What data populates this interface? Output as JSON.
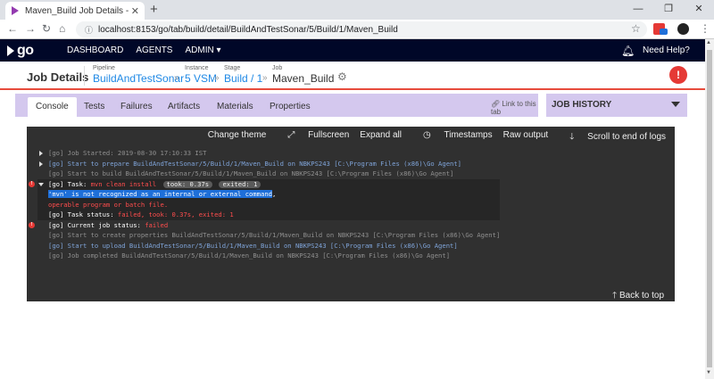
{
  "browser": {
    "tab_title": "Maven_Build Job Details - Go",
    "url": "localhost:8153/go/tab/build/detail/BuildAndTestSonar/5/Build/1/Maven_Build",
    "extension_badge": "1"
  },
  "go_nav": {
    "items": [
      "DASHBOARD",
      "AGENTS",
      "ADMIN ▾"
    ],
    "help": "Need Help?"
  },
  "job": {
    "title": "Job Details",
    "pipeline_label": "Pipeline",
    "pipeline": "BuildAndTestSonar",
    "instance_label": "Instance",
    "instance": "5 VSM",
    "stage_label": "Stage",
    "stage": "Build / 1",
    "job_label": "Job",
    "job": "Maven_Build"
  },
  "tabs": [
    "Console",
    "Tests",
    "Failures",
    "Artifacts",
    "Materials",
    "Properties"
  ],
  "link_to_tab": "Link to this tab",
  "job_history": "JOB HISTORY",
  "console": {
    "toolbar": [
      "Change theme",
      "Fullscreen",
      "Expand all",
      "Timestamps",
      "Raw output",
      "Scroll to end of logs"
    ],
    "lines": {
      "l1": "[go] Job Started: 2019-08-30 17:10:33 IST",
      "l2": "[go] Start to prepare BuildAndTestSonar/5/Build/1/Maven_Build on NBKPS243 [C:\\Program Files (x86)\\Go Agent]",
      "l3": "[go] Start to build BuildAndTestSonar/5/Build/1/Maven_Build on NBKPS243 [C:\\Program Files (x86)\\Go Agent]",
      "task_prefix": "[go] Task: ",
      "task_cmd": "mvn clean install",
      "task_took": "took: 0.37s",
      "task_exited": "exited: 1",
      "err1": "'mvn' is not recognized as an internal or external command",
      "err1_tail": ",",
      "err2": "operable program or batch file.",
      "status_prefix": "[go] Task status: ",
      "status_val": "failed, took: 0.37s, exited: 1",
      "job_status_prefix": "[go] Current job status: ",
      "job_status_val": "failed",
      "l9": "[go] Start to create properties BuildAndTestSonar/5/Build/1/Maven_Build on NBKPS243 [C:\\Program Files (x86)\\Go Agent]",
      "l10": "[go] Start to upload BuildAndTestSonar/5/Build/1/Maven_Build on NBKPS243 [C:\\Program Files (x86)\\Go Agent]",
      "l11": "[go] Job completed BuildAndTestSonar/5/Build/1/Maven_Build on NBKPS243 [C:\\Program Files (x86)\\Go Agent]"
    },
    "back_to_top": "Back to top"
  }
}
